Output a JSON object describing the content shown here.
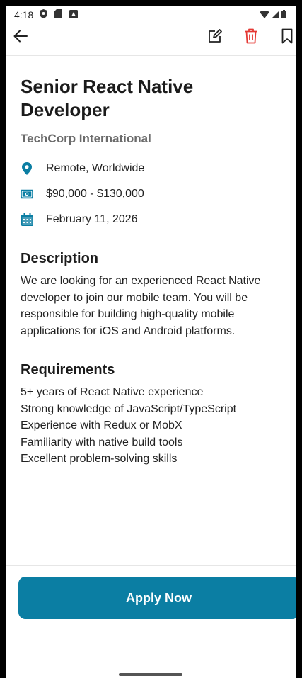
{
  "status_bar": {
    "time": "4:18"
  },
  "colors": {
    "accent": "#0b7ea3",
    "delete": "#e53935",
    "title": "#1b1b1b",
    "company": "#6b6b6b"
  },
  "toolbar": {
    "back_icon": "arrow-left-icon",
    "edit_icon": "edit-icon",
    "delete_icon": "trash-icon",
    "bookmark_icon": "bookmark-icon"
  },
  "job": {
    "title": "Senior React Native Developer",
    "company": "TechCorp International",
    "meta": [
      {
        "icon": "location-icon",
        "text": "Remote, Worldwide"
      },
      {
        "icon": "money-icon",
        "text": "$90,000 - $130,000"
      },
      {
        "icon": "calendar-icon",
        "text": "February 11, 2026"
      }
    ],
    "description_heading": "Description",
    "description": "We are looking for an experienced React Native developer to join our mobile team. You will be responsible for building high-quality mobile applications for iOS and Android platforms.",
    "requirements_heading": "Requirements",
    "requirements": [
      "5+ years of React Native experience",
      "Strong knowledge of JavaScript/TypeScript",
      "Experience with Redux or MobX",
      "Familiarity with native build tools",
      "Excellent problem-solving skills"
    ]
  },
  "footer": {
    "apply_label": "Apply Now"
  }
}
